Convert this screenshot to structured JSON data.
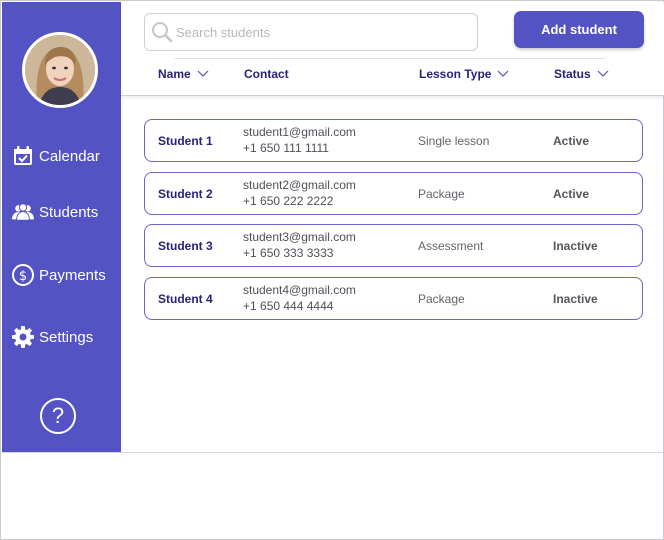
{
  "sidebar": {
    "items": [
      {
        "label": "Calendar",
        "icon": "calendar-icon"
      },
      {
        "label": "Students",
        "icon": "students-icon"
      },
      {
        "label": "Payments",
        "icon": "dollar-icon"
      },
      {
        "label": "Settings",
        "icon": "gear-icon"
      }
    ],
    "help_label": "?"
  },
  "search": {
    "placeholder": "Search students"
  },
  "toolbar": {
    "add_label": "Add student"
  },
  "table": {
    "columns": [
      "Name",
      "Contact",
      "Lesson Type",
      "Status"
    ],
    "rows": [
      {
        "name": "Student 1",
        "email": "student1@gmail.com",
        "phone": "+1 650 111 1111",
        "type": "Single lesson",
        "status": "Active"
      },
      {
        "name": "Student 2",
        "email": "student2@gmail.com",
        "phone": "+1 650 222 2222",
        "type": "Package",
        "status": "Active"
      },
      {
        "name": "Student 3",
        "email": "student3@gmail.com",
        "phone": "+1 650 333 3333",
        "type": "Assessment",
        "status": "Inactive"
      },
      {
        "name": "Student 4",
        "email": "student4@gmail.com",
        "phone": "+1 650 444 4444",
        "type": "Package",
        "status": "Inactive"
      }
    ]
  },
  "colors": {
    "accent": "#5453c4",
    "header_text": "#26237a",
    "row_border": "#6a66c9"
  }
}
